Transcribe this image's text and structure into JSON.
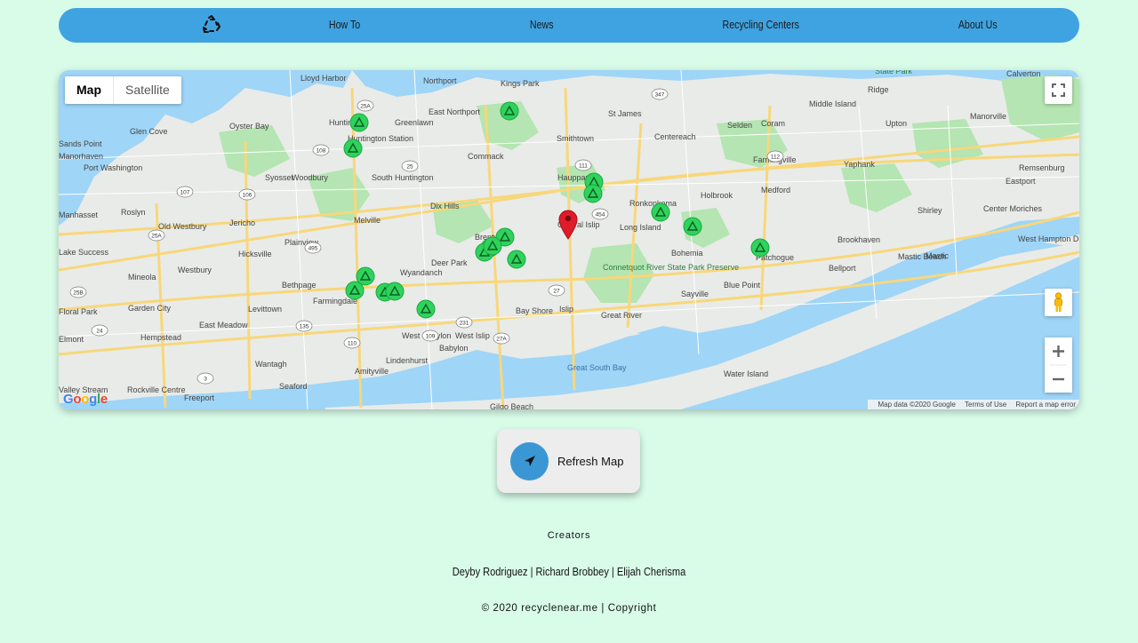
{
  "nav": {
    "logo_icon": "recycle-icon",
    "links": [
      "How To",
      "News",
      "Recycling Centers",
      "About Us"
    ]
  },
  "map": {
    "type_controls": [
      "Map",
      "Satellite"
    ],
    "selected_type": "Map",
    "places": [
      {
        "name": "Northport"
      },
      {
        "name": "East Northport"
      },
      {
        "name": "Kings Park"
      },
      {
        "name": "St James"
      },
      {
        "name": "Lloyd Harbor"
      },
      {
        "name": "Greenlawn"
      },
      {
        "name": "Huntington"
      },
      {
        "name": "Huntington Station"
      },
      {
        "name": "Oyster Bay"
      },
      {
        "name": "Glen Cove"
      },
      {
        "name": "Port Washington"
      },
      {
        "name": "Syosset"
      },
      {
        "name": "Woodbury"
      },
      {
        "name": "South Huntington"
      },
      {
        "name": "Commack"
      },
      {
        "name": "Smithtown"
      },
      {
        "name": "Centereach"
      },
      {
        "name": "Selden"
      },
      {
        "name": "Coram"
      },
      {
        "name": "Middle Island"
      },
      {
        "name": "Ridge"
      },
      {
        "name": "Calverton"
      },
      {
        "name": "Manorville"
      },
      {
        "name": "Upton"
      },
      {
        "name": "Hauppauge"
      },
      {
        "name": "Farmingville"
      },
      {
        "name": "Yaphank"
      },
      {
        "name": "Medford"
      },
      {
        "name": "Holbrook"
      },
      {
        "name": "Ronkonkoma"
      },
      {
        "name": "Remsenburg"
      },
      {
        "name": "Eastport"
      },
      {
        "name": "Dix Hills"
      },
      {
        "name": "Melville"
      },
      {
        "name": "Manhasset"
      },
      {
        "name": "Roslyn"
      },
      {
        "name": "Jericho"
      },
      {
        "name": "Old Westbury"
      },
      {
        "name": "Hicksville"
      },
      {
        "name": "Plainview"
      },
      {
        "name": "Brentwood"
      },
      {
        "name": "Central Islip"
      },
      {
        "name": "Long Island"
      },
      {
        "name": "Shirley"
      },
      {
        "name": "Mastic"
      },
      {
        "name": "Center Moriches"
      },
      {
        "name": "Lake Success"
      },
      {
        "name": "Westbury"
      },
      {
        "name": "Deer Park"
      },
      {
        "name": "Wyandanch"
      },
      {
        "name": "Bohemia"
      },
      {
        "name": "Brookhaven"
      },
      {
        "name": "West Hampton Dunes"
      },
      {
        "name": "Patchogue"
      },
      {
        "name": "Mineola"
      },
      {
        "name": "Bethpage"
      },
      {
        "name": "Farmingdale"
      },
      {
        "name": "Connetquot River State Park Preserve"
      },
      {
        "name": "Bellport"
      },
      {
        "name": "Mastic Beach"
      },
      {
        "name": "Blue Point"
      },
      {
        "name": "Sayville"
      },
      {
        "name": "Floral Park"
      },
      {
        "name": "Garden City"
      },
      {
        "name": "Levittown"
      },
      {
        "name": "Bay Shore"
      },
      {
        "name": "Islip"
      },
      {
        "name": "Great River"
      },
      {
        "name": "West Babylon"
      },
      {
        "name": "Elmont"
      },
      {
        "name": "Hempstead"
      },
      {
        "name": "East Meadow"
      },
      {
        "name": "West Islip"
      },
      {
        "name": "Babylon"
      },
      {
        "name": "Wantagh"
      },
      {
        "name": "Lindenhurst"
      },
      {
        "name": "Amityville"
      },
      {
        "name": "Great South Bay"
      },
      {
        "name": "Water Island"
      },
      {
        "name": "Valley Stream"
      },
      {
        "name": "Rockville Centre"
      },
      {
        "name": "Seaford"
      },
      {
        "name": "Freeport"
      },
      {
        "name": "Gilgo Beach"
      },
      {
        "name": "Sands Point"
      },
      {
        "name": "Manorhaven"
      }
    ],
    "state_park_label": "State Park",
    "route_labels": [
      "25A",
      "108",
      "25",
      "495",
      "135",
      "107",
      "106",
      "454",
      "111",
      "347",
      "112",
      "27",
      "110",
      "109",
      "231",
      "27A",
      "24",
      "25B",
      "25A",
      "3"
    ],
    "recycle_markers": 18,
    "location_marker": "map-pin-icon",
    "attribution": {
      "data": "Map data ©2020 Google",
      "terms": "Terms of Use",
      "report": "Report a map error"
    },
    "google_logo": "Google"
  },
  "refresh": {
    "label": "Refresh Map",
    "icon": "navigation-arrow-icon"
  },
  "footer": {
    "creators_title": "Creators",
    "names": "Deyby Rodriguez | Richard Brobbey | Elijah Cherisma",
    "copyright": "© 2020 recyclenear.me | Copyright"
  },
  "colors": {
    "page_bg": "#d9fce9",
    "nav_bg": "#3fa3e1",
    "water": "#9fd5f7",
    "land": "#e9ebe8",
    "park": "#b4e5b2",
    "marker_green": "#2fd35c",
    "pin_red": "#e01b2a",
    "button_circle": "#3b97d3"
  }
}
